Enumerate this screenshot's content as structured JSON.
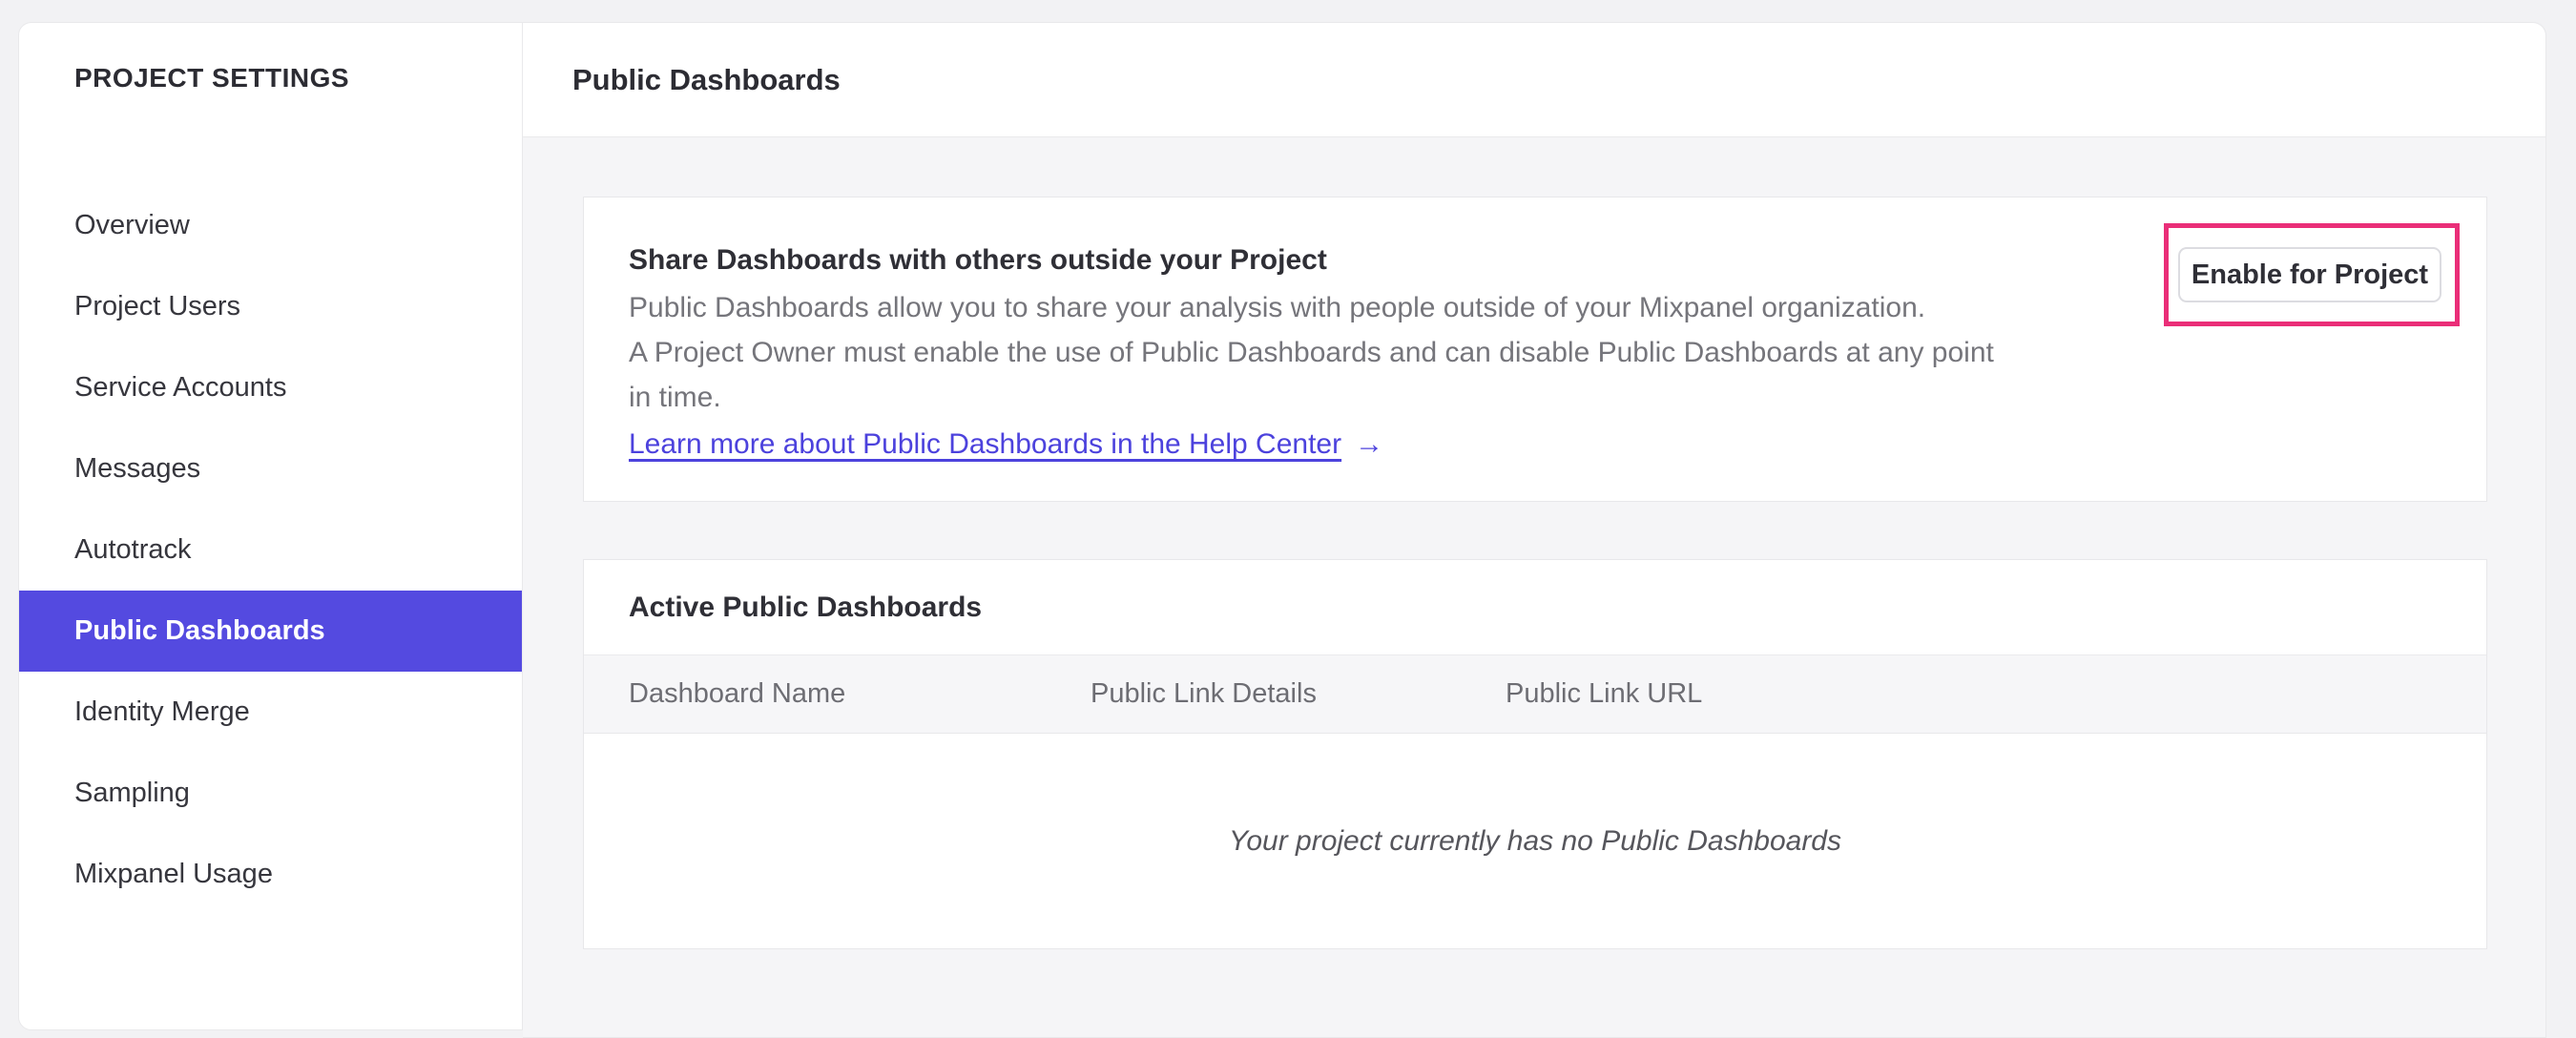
{
  "sidebar": {
    "title": "PROJECT SETTINGS",
    "items": [
      {
        "label": "Overview",
        "selected": false
      },
      {
        "label": "Project Users",
        "selected": false
      },
      {
        "label": "Service Accounts",
        "selected": false
      },
      {
        "label": "Messages",
        "selected": false
      },
      {
        "label": "Autotrack",
        "selected": false
      },
      {
        "label": "Public Dashboards",
        "selected": true
      },
      {
        "label": "Identity Merge",
        "selected": false
      },
      {
        "label": "Sampling",
        "selected": false
      },
      {
        "label": "Mixpanel Usage",
        "selected": false
      }
    ]
  },
  "header": {
    "title": "Public Dashboards"
  },
  "share_card": {
    "title": "Share Dashboards with others outside your Project",
    "description_lines": [
      "Public Dashboards allow you to share your analysis with people outside of your Mixpanel organization.",
      "A Project Owner must enable the use of Public Dashboards and can disable Public Dashboards at any point",
      "in time."
    ],
    "link_label": "Learn more about Public Dashboards in the Help Center",
    "link_arrow": "→",
    "button_label": "Enable for Project"
  },
  "dashboards_card": {
    "title": "Active Public Dashboards",
    "columns": [
      "Dashboard Name",
      "Public Link Details",
      "Public Link URL"
    ],
    "empty_message": "Your project currently has no Public Dashboards"
  },
  "colors": {
    "accent": "#544ae0",
    "link": "#4c42dd",
    "highlight": "#ea2e78"
  }
}
